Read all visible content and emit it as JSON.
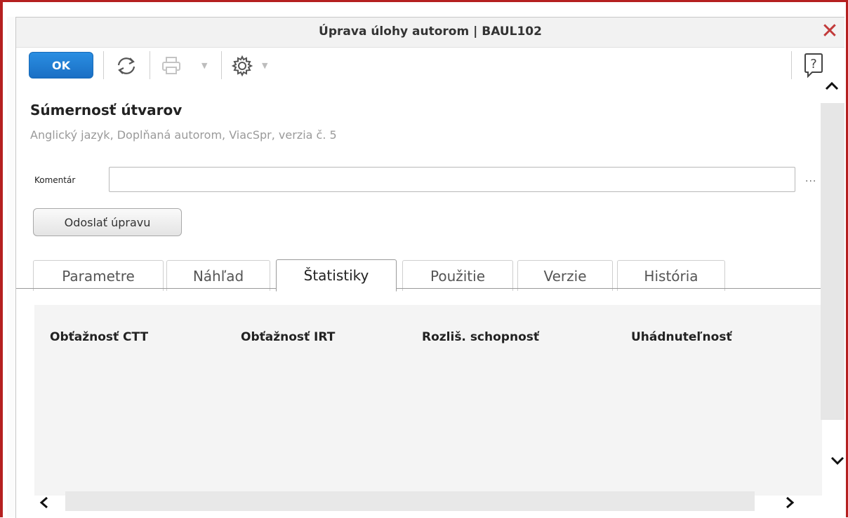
{
  "window": {
    "title": "Úprava úlohy autorom | BAUL102"
  },
  "toolbar": {
    "ok_label": "OK"
  },
  "task": {
    "title": "Súmernosť útvarov",
    "subtitle": "Anglický jazyk, Doplňaná autorom, ViacSpr, verzia č. 5"
  },
  "comment": {
    "label": "Komentár",
    "value": "",
    "more": "..."
  },
  "submit_label": "Odoslať úpravu",
  "tabs": [
    {
      "label": "Parametre"
    },
    {
      "label": "Náhľad"
    },
    {
      "label": "Štatistiky",
      "active": true
    },
    {
      "label": "Použitie"
    },
    {
      "label": "Verzie"
    },
    {
      "label": "História"
    }
  ],
  "stats": {
    "headers": [
      "Obťažnosť CTT",
      "Obťažnosť IRT",
      "Rozliš. schopnosť",
      "Uhádnuteľnosť"
    ]
  },
  "colors": {
    "accent": "#1a7fd8",
    "frame": "#b52020",
    "close": "#c23a3a"
  },
  "icons": {
    "refresh": "refresh-icon",
    "print": "printer-icon",
    "settings": "gear-icon",
    "help": "help-icon"
  }
}
